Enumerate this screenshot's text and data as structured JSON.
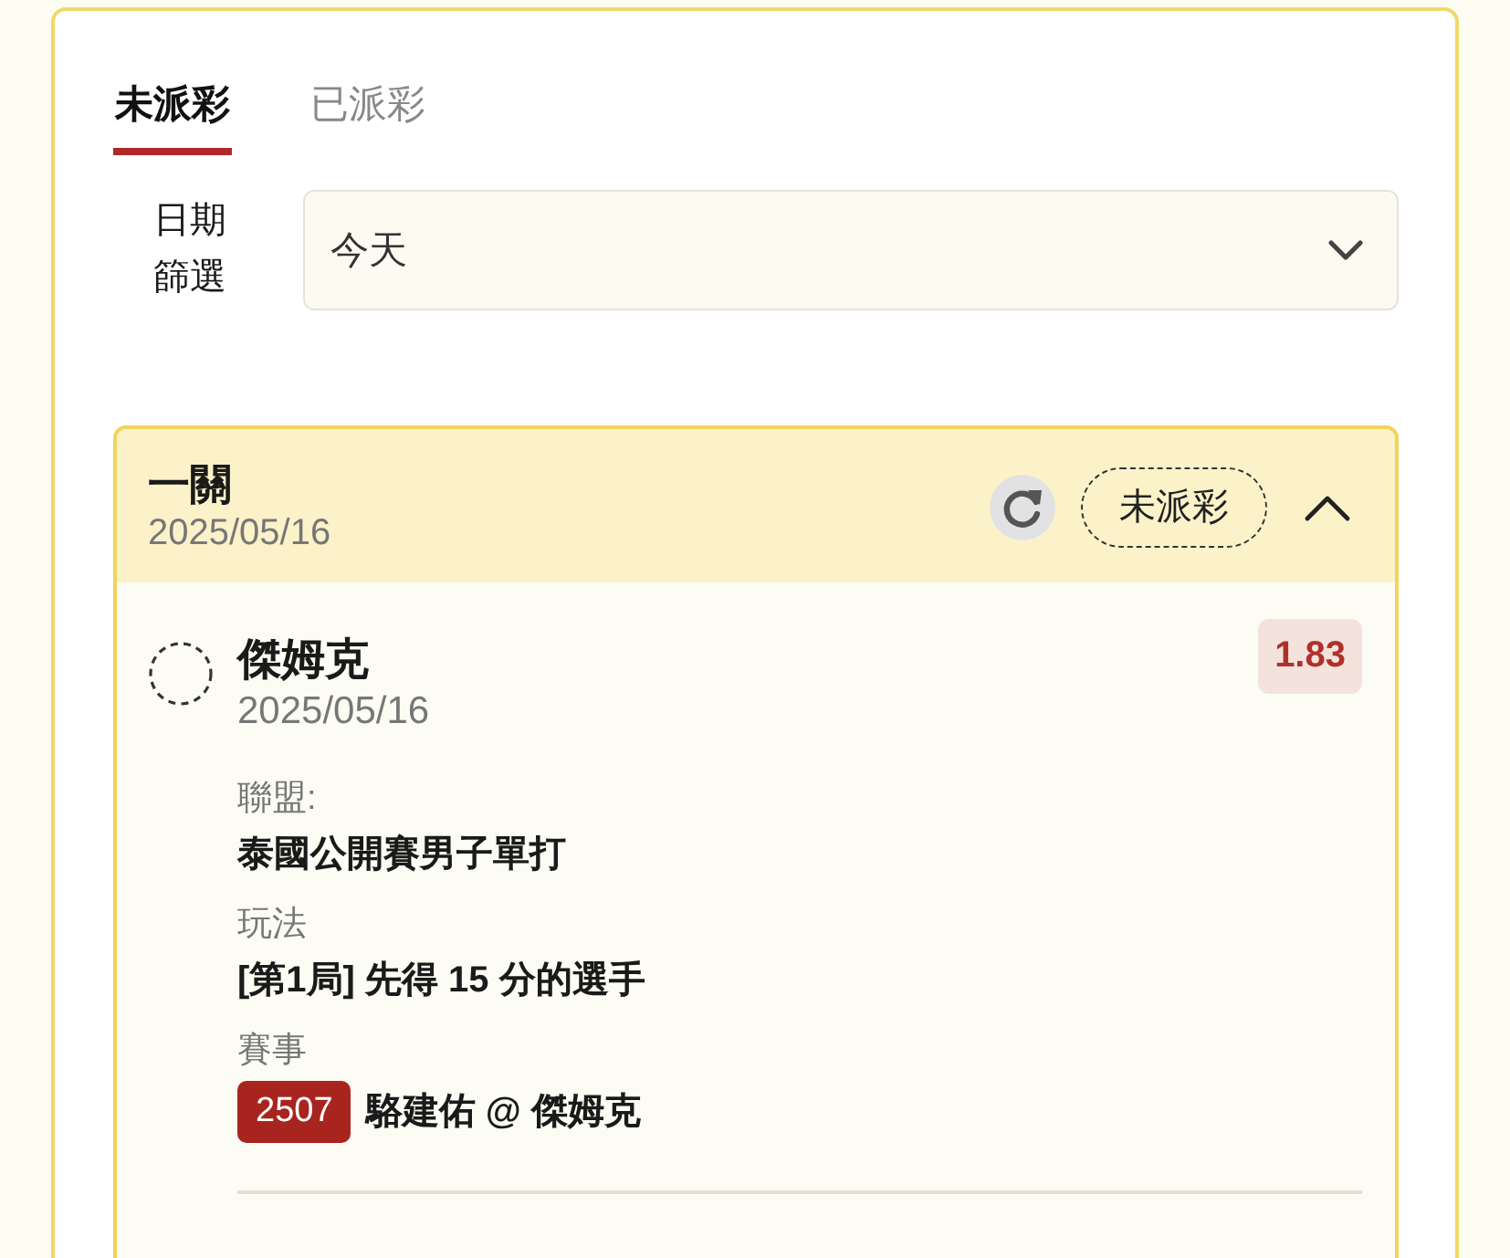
{
  "tabs": [
    {
      "label": "未派彩",
      "selected": true
    },
    {
      "label": "已派彩",
      "selected": false
    }
  ],
  "date_filter": {
    "label": "日期篩選",
    "value": "今天"
  },
  "bets": [
    {
      "type": "一關",
      "date": "2025/05/16",
      "status": "未派彩",
      "expanded": true,
      "selections": [
        {
          "name": "傑姆克",
          "date": "2025/05/16",
          "odds": "1.83",
          "fields": [
            {
              "label": "聯盟:",
              "value": "泰國公開賽男子單打"
            },
            {
              "label": "玩法",
              "value": "[第1局] 先得 15 分的選手"
            },
            {
              "label": "賽事",
              "code": "2507",
              "value": "駱建佑 @ 傑姆克"
            }
          ]
        }
      ]
    }
  ]
}
